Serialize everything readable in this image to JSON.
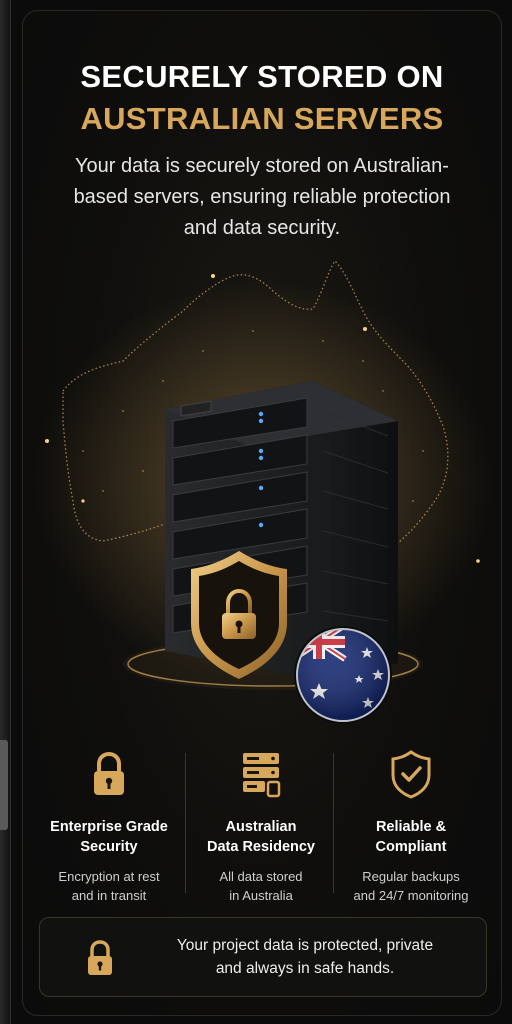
{
  "header": {
    "title_line1": "SECURELY STORED ON",
    "title_line2": "AUSTRALIAN SERVERS",
    "subtitle": "Your data is securely stored on Australian-based servers, ensuring reliable protection and data security."
  },
  "colors": {
    "accent_gold": "#d7a85b",
    "background": "#0b0b0c",
    "text_white": "#ffffff"
  },
  "hero_icons": [
    "australia-map",
    "server-rack",
    "shield-lock-icon",
    "australian-flag-badge"
  ],
  "features": [
    {
      "icon": "padlock-icon",
      "title_line1": "Enterprise Grade",
      "title_line2": "Security",
      "desc_line1": "Encryption at rest",
      "desc_line2": "and in transit"
    },
    {
      "icon": "server-stack-icon",
      "title_line1": "Australian",
      "title_line2": "Data Residency",
      "desc_line1": "All data stored",
      "desc_line2": "in Australia"
    },
    {
      "icon": "shield-check-icon",
      "title_line1": "Reliable &",
      "title_line2": "Compliant",
      "desc_line1": "Regular backups",
      "desc_line2": "and 24/7 monitoring"
    }
  ],
  "notice": {
    "icon": "padlock-icon",
    "line1": "Your project data is protected, private",
    "line2": "and always in safe hands."
  }
}
